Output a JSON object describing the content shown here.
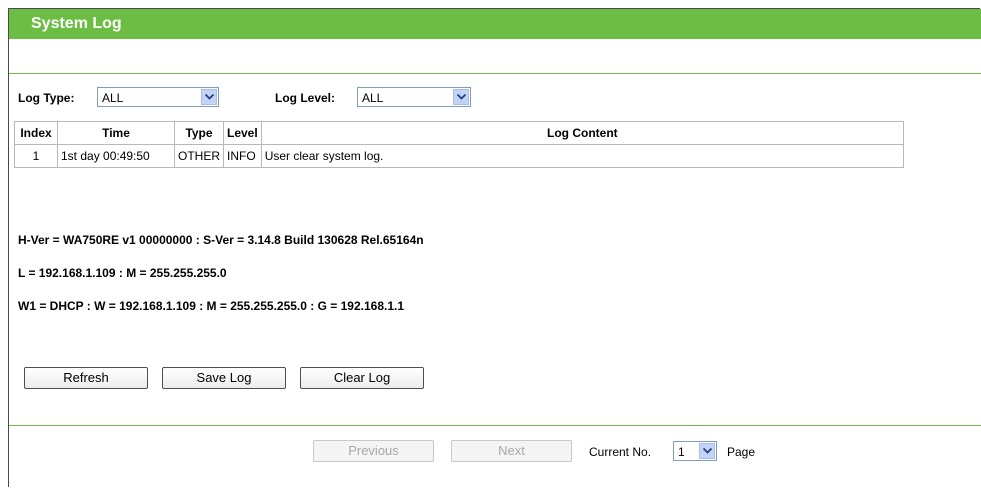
{
  "header": {
    "title": "System Log"
  },
  "filters": {
    "log_type_label": "Log Type:",
    "log_type_value": "ALL",
    "log_level_label": "Log Level:",
    "log_level_value": "ALL"
  },
  "table": {
    "headers": [
      "Index",
      "Time",
      "Type",
      "Level",
      "Log Content"
    ],
    "rows": [
      [
        "1",
        "1st day 00:49:50",
        "OTHER",
        "INFO",
        "User clear system log."
      ]
    ]
  },
  "info": {
    "line1": "H-Ver = WA750RE v1 00000000 : S-Ver = 3.14.8 Build 130628 Rel.65164n",
    "line2": "L = 192.168.1.109 : M = 255.255.255.0",
    "line3": "W1 = DHCP : W = 192.168.1.109 : M = 255.255.255.0 : G = 192.168.1.1"
  },
  "buttons": {
    "refresh": "Refresh",
    "save_log": "Save Log",
    "clear_log": "Clear Log"
  },
  "pager": {
    "previous": "Previous",
    "next": "Next",
    "current_label": "Current No.",
    "current_value": "1",
    "page_label": "Page"
  },
  "colors": {
    "accent": "#6bbd43",
    "select_arrow": "#c1d3fb"
  }
}
